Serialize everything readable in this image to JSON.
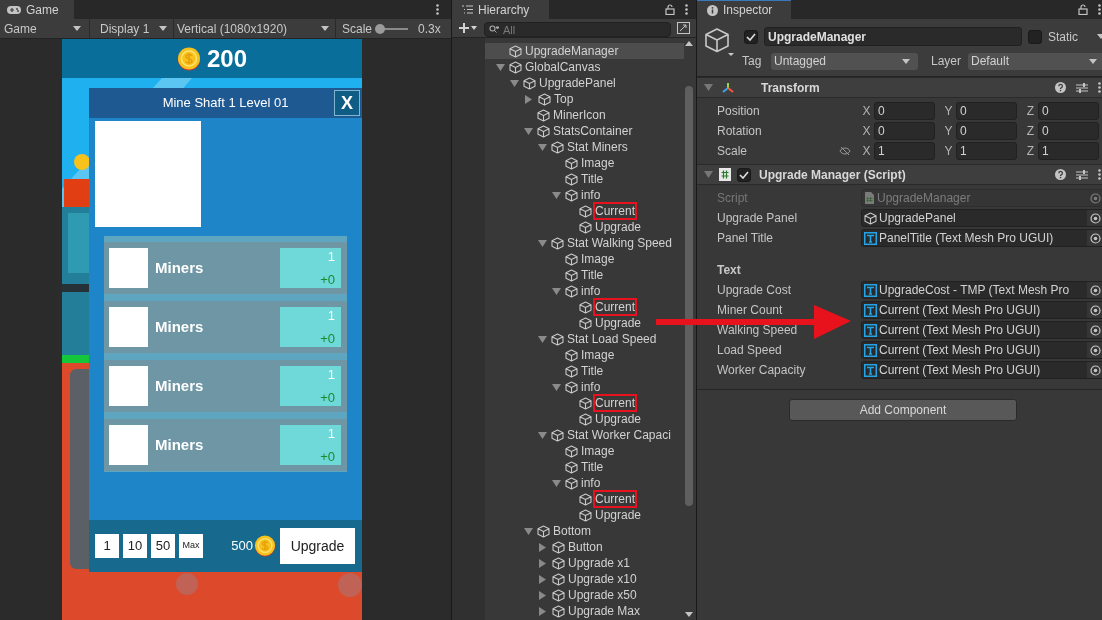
{
  "game_panel": {
    "tab": "Game",
    "toolbar": {
      "view": "Game",
      "display": "Display 1",
      "resolution": "Vertical (1080x1920)",
      "scale_label": "Scale",
      "scale": {
        "level": 0.05
      },
      "scale_reading": "0.3x"
    },
    "hud": {
      "coins": "200"
    },
    "upgrade_panel": {
      "title": "Mine Shaft 1 Level 01",
      "close": "X",
      "stats": [
        {
          "title": "Miners",
          "current": "1",
          "upgrade": "+0"
        },
        {
          "title": "Miners",
          "current": "1",
          "upgrade": "+0"
        },
        {
          "title": "Miners",
          "current": "1",
          "upgrade": "+0"
        },
        {
          "title": "Miners",
          "current": "1",
          "upgrade": "+0"
        }
      ],
      "amounts": [
        {
          "label": "1"
        },
        {
          "label": "10"
        },
        {
          "label": "50"
        },
        {
          "label": "Max"
        }
      ],
      "cost": "500",
      "upgrade_button": "Upgrade"
    }
  },
  "hierarchy": {
    "tab": "Hierarchy",
    "search": {
      "placeholder": "All"
    },
    "tree": [
      {
        "label": "UpgradeManager",
        "selected": true,
        "highlighted": false
      },
      {
        "label": "GlobalCanvas",
        "expanded": true,
        "selected": false,
        "highlighted": false,
        "children": [
          {
            "label": "UpgradePanel",
            "expanded": true,
            "selected": false,
            "highlighted": false,
            "children": [
              {
                "label": "Top",
                "expanded": false,
                "selected": false,
                "highlighted": false
              },
              {
                "label": "MinerIcon",
                "selected": false,
                "highlighted": false
              },
              {
                "label": "StatsContainer",
                "expanded": true,
                "selected": false,
                "highlighted": false,
                "children": [
                  {
                    "label": "Stat Miners",
                    "expanded": true,
                    "selected": false,
                    "highlighted": false,
                    "children": [
                      {
                        "label": "Image",
                        "selected": false,
                        "highlighted": false
                      },
                      {
                        "label": "Title",
                        "selected": false,
                        "highlighted": false
                      },
                      {
                        "label": "info",
                        "expanded": true,
                        "selected": false,
                        "highlighted": false,
                        "children": [
                          {
                            "label": "Current",
                            "selected": false,
                            "highlighted": true
                          },
                          {
                            "label": "Upgrade",
                            "selected": false,
                            "highlighted": false
                          }
                        ]
                      }
                    ]
                  },
                  {
                    "label": "Stat Walking Speed",
                    "expanded": true,
                    "selected": false,
                    "highlighted": false,
                    "children": [
                      {
                        "label": "Image",
                        "selected": false,
                        "highlighted": false
                      },
                      {
                        "label": "Title",
                        "selected": false,
                        "highlighted": false
                      },
                      {
                        "label": "info",
                        "expanded": true,
                        "selected": false,
                        "highlighted": false,
                        "children": [
                          {
                            "label": "Current",
                            "selected": false,
                            "highlighted": true
                          },
                          {
                            "label": "Upgrade",
                            "selected": false,
                            "highlighted": false
                          }
                        ]
                      }
                    ]
                  },
                  {
                    "label": "Stat Load Speed",
                    "expanded": true,
                    "selected": false,
                    "highlighted": false,
                    "children": [
                      {
                        "label": "Image",
                        "selected": false,
                        "highlighted": false
                      },
                      {
                        "label": "Title",
                        "selected": false,
                        "highlighted": false
                      },
                      {
                        "label": "info",
                        "expanded": true,
                        "selected": false,
                        "highlighted": false,
                        "children": [
                          {
                            "label": "Current",
                            "selected": false,
                            "highlighted": true
                          },
                          {
                            "label": "Upgrade",
                            "selected": false,
                            "highlighted": false
                          }
                        ]
                      }
                    ]
                  },
                  {
                    "label": "Stat Worker Capaci",
                    "expanded": true,
                    "selected": false,
                    "highlighted": false,
                    "children": [
                      {
                        "label": "Image",
                        "selected": false,
                        "highlighted": false
                      },
                      {
                        "label": "Title",
                        "selected": false,
                        "highlighted": false
                      },
                      {
                        "label": "info",
                        "expanded": true,
                        "selected": false,
                        "highlighted": false,
                        "children": [
                          {
                            "label": "Current",
                            "selected": false,
                            "highlighted": true
                          },
                          {
                            "label": "Upgrade",
                            "selected": false,
                            "highlighted": false
                          }
                        ]
                      }
                    ]
                  }
                ]
              },
              {
                "label": "Bottom",
                "expanded": true,
                "selected": false,
                "highlighted": false,
                "children": [
                  {
                    "label": "Button",
                    "expanded": false,
                    "selected": false,
                    "highlighted": false
                  },
                  {
                    "label": "Upgrade x1",
                    "expanded": false,
                    "selected": false,
                    "highlighted": false
                  },
                  {
                    "label": "Upgrade x10",
                    "expanded": false,
                    "selected": false,
                    "highlighted": false
                  },
                  {
                    "label": "Upgrade x50",
                    "expanded": false,
                    "selected": false,
                    "highlighted": false
                  },
                  {
                    "label": "Upgrade Max",
                    "expanded": false,
                    "selected": false,
                    "highlighted": false
                  }
                ]
              }
            ]
          }
        ]
      }
    ]
  },
  "inspector": {
    "tab": "Inspector",
    "object": {
      "active": true,
      "name": "UpgradeManager",
      "static": false,
      "static_label": "Static",
      "tag_label": "Tag",
      "tag": "Untagged",
      "layer_label": "Layer",
      "layer": "Default"
    },
    "components": [
      {
        "kind": "transform",
        "title": "Transform",
        "rows": [
          {
            "kind": "vector",
            "label": "Position",
            "values": [
              {
                "axis": "X",
                "value": "0"
              },
              {
                "axis": "Y",
                "value": "0"
              },
              {
                "axis": "Z",
                "value": "0"
              }
            ]
          },
          {
            "kind": "vector",
            "label": "Rotation",
            "values": [
              {
                "axis": "X",
                "value": "0"
              },
              {
                "axis": "Y",
                "value": "0"
              },
              {
                "axis": "Z",
                "value": "0"
              }
            ]
          },
          {
            "kind": "scale",
            "label": "Scale",
            "values": [
              {
                "axis": "X",
                "value": "1"
              },
              {
                "axis": "Y",
                "value": "1"
              },
              {
                "axis": "Z",
                "value": "1"
              }
            ]
          }
        ]
      },
      {
        "kind": "script",
        "title": "Upgrade Manager (Script)",
        "enabled": true,
        "fields": [
          {
            "kind": "script_ref",
            "label": "Script",
            "value": "UpgradeManager",
            "disabled": true
          },
          {
            "kind": "object_ref",
            "label": "Upgrade Panel",
            "value": "UpgradePanel",
            "disabled": false
          },
          {
            "kind": "text_ref",
            "label": "Panel Title",
            "value": "PanelTitle (Text Mesh Pro UGUI)",
            "disabled": false
          },
          {
            "kind": "header",
            "label": "Text"
          },
          {
            "kind": "text_ref",
            "label": "Upgrade Cost",
            "value": "UpgradeCost - TMP (Text Mesh Pro",
            "disabled": false
          },
          {
            "kind": "text_ref",
            "label": "Miner Count",
            "value": "Current (Text Mesh Pro UGUI)",
            "disabled": false
          },
          {
            "kind": "text_ref",
            "label": "Walking Speed",
            "value": "Current (Text Mesh Pro UGUI)",
            "disabled": false
          },
          {
            "kind": "text_ref",
            "label": "Load Speed",
            "value": "Current (Text Mesh Pro UGUI)",
            "disabled": false
          },
          {
            "kind": "text_ref",
            "label": "Worker Capacity",
            "value": "Current (Text Mesh Pro UGUI)",
            "disabled": false
          }
        ]
      }
    ],
    "add_component": "Add Component"
  }
}
